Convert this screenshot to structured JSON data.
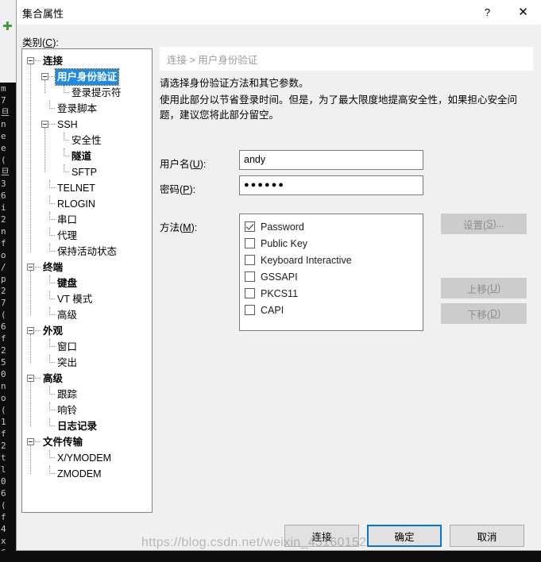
{
  "background": {
    "plus_icon": "plus-icon",
    "side_text": "m\n7\n旦\nn\ne\ne\n(\n旦\n3\n6\ni\n2\nn\nf\no\n/\np\n2\n7\n(\n6\nf\n2\n5\n0\nn\no\n(\n1\nf\n2\nt\nl\n0\n6\n(\nf\n4\nx\n6"
  },
  "window": {
    "title": "集合属性",
    "help_label": "?",
    "close_label": "✕"
  },
  "category": {
    "label_prefix": "类别(",
    "label_key": "C",
    "label_suffix": "):"
  },
  "tree": {
    "items": [
      {
        "label": "连接",
        "level": 0,
        "bold": true,
        "expander": true,
        "selected": false
      },
      {
        "label": "用户身份验证",
        "level": 1,
        "bold": true,
        "expander": true,
        "selected": true
      },
      {
        "label": "登录提示符",
        "level": 2,
        "bold": false,
        "expander": false,
        "selected": false
      },
      {
        "label": "登录脚本",
        "level": 1,
        "bold": false,
        "expander": false,
        "selected": false
      },
      {
        "label": "SSH",
        "level": 1,
        "bold": false,
        "expander": true,
        "selected": false
      },
      {
        "label": "安全性",
        "level": 2,
        "bold": false,
        "expander": false,
        "selected": false
      },
      {
        "label": "隧道",
        "level": 2,
        "bold": true,
        "expander": false,
        "selected": false
      },
      {
        "label": "SFTP",
        "level": 2,
        "bold": false,
        "expander": false,
        "selected": false
      },
      {
        "label": "TELNET",
        "level": 1,
        "bold": false,
        "expander": false,
        "selected": false
      },
      {
        "label": "RLOGIN",
        "level": 1,
        "bold": false,
        "expander": false,
        "selected": false
      },
      {
        "label": "串口",
        "level": 1,
        "bold": false,
        "expander": false,
        "selected": false
      },
      {
        "label": "代理",
        "level": 1,
        "bold": false,
        "expander": false,
        "selected": false
      },
      {
        "label": "保持活动状态",
        "level": 1,
        "bold": false,
        "expander": false,
        "selected": false
      },
      {
        "label": "终端",
        "level": 0,
        "bold": true,
        "expander": true,
        "selected": false
      },
      {
        "label": "键盘",
        "level": 1,
        "bold": true,
        "expander": false,
        "selected": false
      },
      {
        "label": "VT 模式",
        "level": 1,
        "bold": false,
        "expander": false,
        "selected": false
      },
      {
        "label": "高级",
        "level": 1,
        "bold": false,
        "expander": false,
        "selected": false
      },
      {
        "label": "外观",
        "level": 0,
        "bold": true,
        "expander": true,
        "selected": false
      },
      {
        "label": "窗口",
        "level": 1,
        "bold": false,
        "expander": false,
        "selected": false
      },
      {
        "label": "突出",
        "level": 1,
        "bold": false,
        "expander": false,
        "selected": false
      },
      {
        "label": "高级",
        "level": 0,
        "bold": true,
        "expander": true,
        "selected": false
      },
      {
        "label": "跟踪",
        "level": 1,
        "bold": false,
        "expander": false,
        "selected": false
      },
      {
        "label": "响铃",
        "level": 1,
        "bold": false,
        "expander": false,
        "selected": false
      },
      {
        "label": "日志记录",
        "level": 1,
        "bold": true,
        "expander": false,
        "selected": false
      },
      {
        "label": "文件传输",
        "level": 0,
        "bold": true,
        "expander": true,
        "selected": false
      },
      {
        "label": "X/YMODEM",
        "level": 1,
        "bold": false,
        "expander": false,
        "selected": false
      },
      {
        "label": "ZMODEM",
        "level": 1,
        "bold": false,
        "expander": false,
        "selected": false
      }
    ]
  },
  "content": {
    "breadcrumb": "连接 > 用户身份验证",
    "description_1": "请选择身份验证方法和其它参数。",
    "description_2": "使用此部分以节省登录时间。但是，为了最大限度地提高安全性，如果担心安全问题，建议您将此部分留空。",
    "username_label": "用户名(U):",
    "username_value": "andy",
    "password_label": "密码(P):",
    "password_value": "●●●●●●",
    "methods_label": "方法(M):",
    "methods": [
      {
        "label": "Password",
        "checked": true
      },
      {
        "label": "Public Key",
        "checked": false
      },
      {
        "label": "Keyboard Interactive",
        "checked": false
      },
      {
        "label": "GSSAPI",
        "checked": false
      },
      {
        "label": "PKCS11",
        "checked": false
      },
      {
        "label": "CAPI",
        "checked": false
      }
    ],
    "settings_button": "设置(S)...",
    "move_up_button": "上移(U)",
    "move_down_button": "下移(D)"
  },
  "footer": {
    "connect_button": "连接",
    "ok_button": "确定",
    "cancel_button": "取消"
  },
  "watermark": "https://blog.csdn.net/weixin_45160152",
  "colors": {
    "selection_blue": "#1e8ae8",
    "focus_border_blue": "#0078d7",
    "dialog_background": "#f0f0f0",
    "breadcrumb_text": "#9b9b9b",
    "disabled_button": "#cccccc",
    "terminal_background": "#0c0c0c"
  }
}
